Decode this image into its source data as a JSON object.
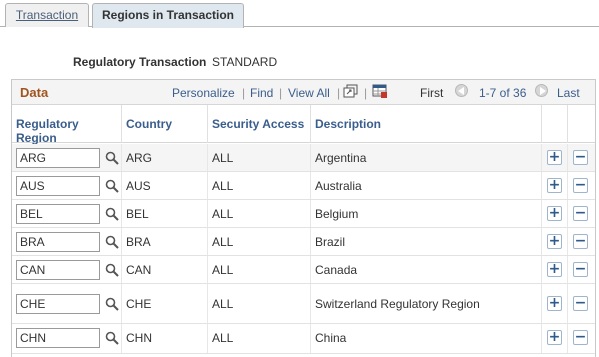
{
  "tabs": [
    {
      "label": "Transaction"
    },
    {
      "label": "Regions in Transaction"
    }
  ],
  "header": {
    "field_label": "Regulatory Transaction",
    "field_value": "STANDARD"
  },
  "grid": {
    "title": "Data",
    "personalize": "Personalize",
    "find": "Find",
    "view_all": "View All",
    "first": "First",
    "range": "1-7 of 36",
    "last": "Last",
    "columns": [
      "Regulatory Region",
      "Country",
      "Security Access",
      "Description"
    ],
    "rows": [
      {
        "region": "ARG",
        "country": "ARG",
        "access": "ALL",
        "description": "Argentina"
      },
      {
        "region": "AUS",
        "country": "AUS",
        "access": "ALL",
        "description": "Australia"
      },
      {
        "region": "BEL",
        "country": "BEL",
        "access": "ALL",
        "description": "Belgium"
      },
      {
        "region": "BRA",
        "country": "BRA",
        "access": "ALL",
        "description": "Brazil"
      },
      {
        "region": "CAN",
        "country": "CAN",
        "access": "ALL",
        "description": "Canada"
      },
      {
        "region": "CHE",
        "country": "CHE",
        "access": "ALL",
        "description": "Switzerland Regulatory Region"
      },
      {
        "region": "CHN",
        "country": "CHN",
        "access": "ALL",
        "description": "China"
      }
    ],
    "add_symbol": "+",
    "delete_symbol": "−"
  },
  "colors": {
    "accent_title": "#a0541f",
    "link": "#3a5e8c",
    "active_tab": "#dfe7ef"
  },
  "icons": [
    "lookup-icon",
    "zoom-grid-icon",
    "download-grid-icon",
    "prev-page-icon",
    "next-page-icon",
    "add-row-icon",
    "delete-row-icon"
  ]
}
